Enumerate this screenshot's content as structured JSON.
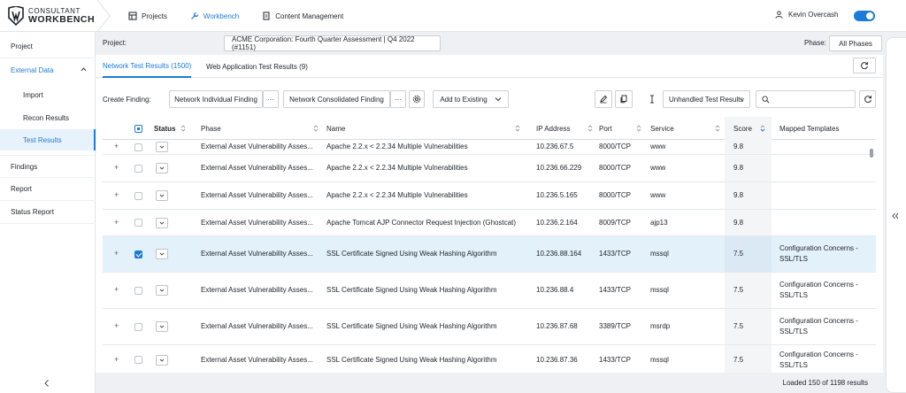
{
  "header": {
    "logo_line1": "CONSULTANT",
    "logo_line2": "WORKBENCH",
    "nav": [
      {
        "label": "Projects",
        "icon": "grid-icon"
      },
      {
        "label": "Workbench",
        "icon": "wrench-icon",
        "active": true
      },
      {
        "label": "Content Management",
        "icon": "document-icon"
      }
    ],
    "user_name": "Kevin Overcash",
    "accent_color": "#1d7bd8"
  },
  "sidebar": {
    "items": [
      {
        "label": "Project"
      },
      {
        "label": "External Data",
        "expanded": true
      },
      {
        "label": "Import",
        "sub": true
      },
      {
        "label": "Recon Results",
        "sub": true
      },
      {
        "label": "Test Results",
        "sub": true,
        "active": true
      },
      {
        "label": "Findings"
      },
      {
        "label": "Report"
      },
      {
        "label": "Status Report"
      }
    ]
  },
  "project": {
    "label": "Project:",
    "value": "ACME Corporation: Fourth Quarter Assessment | Q4 2022 (#1151)",
    "phase_label": "Phase:",
    "phase_value": "All Phases"
  },
  "tabs": [
    {
      "label": "Network Test Results (1500)",
      "active": true
    },
    {
      "label": "Web Application Test Results (9)"
    }
  ],
  "toolbar": {
    "create_label": "Create Finding:",
    "individual": "Network Individual Finding",
    "more": "···",
    "consolidated": "Network Consolidated Finding",
    "add_existing": "Add to Existing",
    "filter": "Unhandled Test Results",
    "search_placeholder": ""
  },
  "table": {
    "columns": [
      "Status",
      "Phase",
      "Name",
      "IP Address",
      "Port",
      "Service",
      "Score",
      "Mapped Templates"
    ],
    "rows": [
      {
        "phase": "External Asset Vulnerability Asses...",
        "name": "Apache 2.2.x < 2.2.34 Multiple Vulnerabilities",
        "ip": "10.236.67.5",
        "port": "8000/TCP",
        "service": "www",
        "score": "9.8",
        "template1": "",
        "template2": "",
        "checked": false
      },
      {
        "phase": "External Asset Vulnerability Asses...",
        "name": "Apache 2.2.x < 2.2.34 Multiple Vulnerabilities",
        "ip": "10.236.66.229",
        "port": "8000/TCP",
        "service": "www",
        "score": "9.8",
        "template1": "",
        "template2": "",
        "checked": false
      },
      {
        "phase": "External Asset Vulnerability Asses...",
        "name": "Apache 2.2.x < 2.2.34 Multiple Vulnerabilities",
        "ip": "10.236.5.165",
        "port": "8000/TCP",
        "service": "www",
        "score": "9.8",
        "template1": "",
        "template2": "",
        "checked": false
      },
      {
        "phase": "External Asset Vulnerability Asses...",
        "name": "Apache Tomcat AJP Connector Request Injection (Ghostcat)",
        "ip": "10.236.2.164",
        "port": "8009/TCP",
        "service": "ajp13",
        "score": "9.8",
        "template1": "",
        "template2": "",
        "checked": false
      },
      {
        "phase": "External Asset Vulnerability Asses...",
        "name": "SSL Certificate Signed Using Weak Hashing Algorithm",
        "ip": "10.236.88.164",
        "port": "1433/TCP",
        "service": "mssql",
        "score": "7.5",
        "template1": "Configuration Concerns -",
        "template2": "SSL/TLS",
        "checked": true
      },
      {
        "phase": "External Asset Vulnerability Asses...",
        "name": "SSL Certificate Signed Using Weak Hashing Algorithm",
        "ip": "10.236.88.4",
        "port": "1433/TCP",
        "service": "mssql",
        "score": "7.5",
        "template1": "Configuration Concerns -",
        "template2": "SSL/TLS",
        "checked": false
      },
      {
        "phase": "External Asset Vulnerability Asses...",
        "name": "SSL Certificate Signed Using Weak Hashing Algorithm",
        "ip": "10.236.87.68",
        "port": "3389/TCP",
        "service": "msrdp",
        "score": "7.5",
        "template1": "Configuration Concerns -",
        "template2": "SSL/TLS",
        "checked": false
      },
      {
        "phase": "External Asset Vulnerability Asses...",
        "name": "SSL Certificate Signed Using Weak Hashing Algorithm",
        "ip": "10.236.87.36",
        "port": "1433/TCP",
        "service": "mssql",
        "score": "7.5",
        "template1": "Configuration Concerns -",
        "template2": "SSL/TLS",
        "checked": false
      }
    ]
  },
  "footer": {
    "text": "Loaded 150 of 1198 results"
  }
}
